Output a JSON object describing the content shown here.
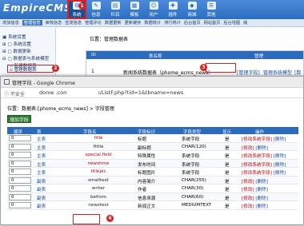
{
  "app": {
    "logo": "EmpireCMS"
  },
  "topnav": [
    {
      "label": "系统",
      "icon": "system-icon",
      "active": true
    },
    {
      "label": "信息",
      "icon": "info-icon"
    },
    {
      "label": "栏目",
      "icon": "column-icon"
    },
    {
      "label": "模板",
      "icon": "template-icon"
    },
    {
      "label": "用户",
      "icon": "user-icon"
    },
    {
      "label": "插件",
      "icon": "plugin-icon"
    },
    {
      "label": "商城",
      "icon": "shop-icon"
    },
    {
      "label": "其他",
      "icon": "other-icon"
    }
  ],
  "subnav": [
    "增加信息",
    "管理信息",
    "审核信息",
    "签发信息",
    "管理评论",
    "数据更新",
    "更新缓存",
    "数据统计",
    "排行统计",
    "后台首页",
    "网站首页",
    "后台地图",
    "版"
  ],
  "subnav_active_index": 1,
  "sidebar": {
    "items": [
      "系统设置",
      "系统设置",
      "数据更新",
      "数据表与系统模型",
      "新建数据表",
      "管理数据表",
      "管理系统模型"
    ]
  },
  "bg_main": {
    "position": "位置：管理数据表",
    "headers": [
      "ID",
      "表名称",
      "管理"
    ],
    "row": {
      "id": "1",
      "name": "新闻系统数据表（phome_ecms_news）",
      "op1": "[管理字段]",
      "op2": "管理系统模型",
      "op3": "[数据"
    }
  },
  "badges": [
    "1",
    "2",
    "3",
    "4"
  ],
  "popup": {
    "title": "管理字段 - Google Chrome",
    "info": "不安全",
    "url": "dome                  .com/e/admin/db/ListF.php?tid=1&tbname=news",
    "breadcrumb": "位置：数据表:[phome_ecms_news] > 字段管理",
    "add_button": "增加字段",
    "headers": [
      "顺序",
      "表",
      "字段名",
      "字段标识",
      "字段类型",
      "显示",
      "操作"
    ],
    "rows": [
      {
        "order": "0",
        "table": "主表",
        "field": "title",
        "label": "标题",
        "type": "系统字段",
        "show": "是",
        "edit": "[修改系统字段]",
        "del": "[删除]"
      },
      {
        "order": "0",
        "table": "主表",
        "field": "ftitle",
        "label": "副标题",
        "type": "CHAR(120)",
        "show": "是",
        "edit": "[修改]",
        "del": "[删除]",
        "main": true
      },
      {
        "order": "0",
        "table": "主表",
        "field": "special.field",
        "label": "特殊属性",
        "type": "系统字段",
        "show": "是",
        "edit": "[修改系统字段]",
        "del": "[删除]"
      },
      {
        "order": "0",
        "table": "主表",
        "field": "newstime",
        "label": "发布时间",
        "type": "系统字段",
        "show": "是",
        "edit": "[修改系统字段]",
        "del": "[删除]"
      },
      {
        "order": "0",
        "table": "主表",
        "field": "titlepic",
        "label": "标题图片",
        "type": "系统字段",
        "show": "是",
        "edit": "[修改系统字段]",
        "del": "[删除]"
      },
      {
        "order": "0",
        "table": "副表",
        "field": "smalltext",
        "label": "内容简介",
        "type": "CHAR(255)",
        "show": "是",
        "edit": "[修改]",
        "del": "[删除]",
        "main": true
      },
      {
        "order": "0",
        "table": "副表",
        "field": "writer",
        "label": "作者",
        "type": "CHAR(30)",
        "show": "是",
        "edit": "[修改]",
        "del": "[删除]",
        "main": true
      },
      {
        "order": "0",
        "table": "副表",
        "field": "befrom",
        "label": "信息来源",
        "type": "CHAR(60)",
        "show": "是",
        "edit": "[修改]",
        "del": "[删除]",
        "main": true
      },
      {
        "order": "0",
        "table": "副表",
        "field": "newstext",
        "label": "新闻正文",
        "type": "MEDIUMTEXT",
        "show": "是",
        "edit": "[修改]",
        "del": "[删除]",
        "main": true
      }
    ]
  }
}
